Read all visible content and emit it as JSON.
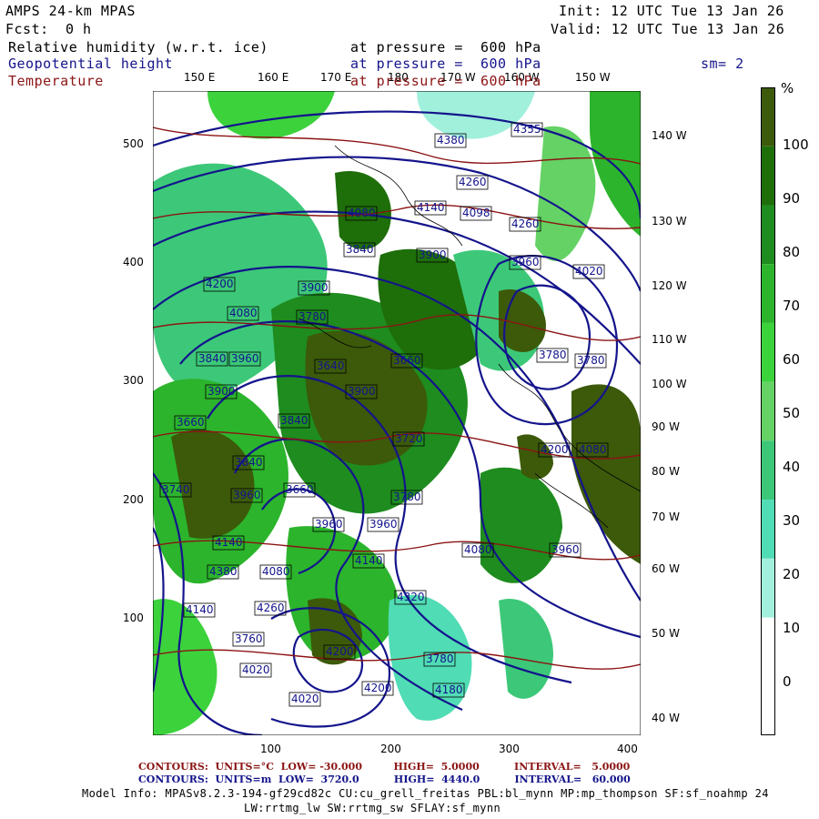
{
  "header": {
    "model": "AMPS 24-km MPAS",
    "init": "Init: 12 UTC Tue 13 Jan 26",
    "fcst_label": "Fcst:",
    "fcst_value": "0 h",
    "valid": "Valid: 12 UTC Tue 13 Jan 26",
    "smoothing": "sm= 2"
  },
  "fields": [
    {
      "name": "Relative humidity (w.r.t. ice)",
      "level": "at pressure =  600 hPa",
      "color": "#000000"
    },
    {
      "name": "Geopotential height",
      "level": "at pressure =  600 hPa",
      "color": "#14148c"
    },
    {
      "name": "Temperature",
      "level": "at pressure =  600 hPa",
      "color": "#8c1414"
    }
  ],
  "top_longitudes": [
    "150 E",
    "160 E",
    "170 E",
    "180",
    "170 W",
    "160 W",
    "150 W"
  ],
  "right_longitudes": [
    "140 W",
    "130 W",
    "120 W",
    "110 W",
    "100 W",
    "90 W",
    "80 W",
    "70 W",
    "60 W",
    "50 W",
    "40 W"
  ],
  "y_ticks": [
    "500",
    "400",
    "300",
    "200",
    "100"
  ],
  "x_ticks": [
    "100",
    "200",
    "300",
    "400"
  ],
  "colorbar": {
    "unit": "%",
    "labels": [
      "100",
      "90",
      "80",
      "70",
      "60",
      "50",
      "40",
      "30",
      "20",
      "10",
      "0"
    ],
    "colors": [
      "#3c5a0a",
      "#1e6e0a",
      "#1e8c1e",
      "#2cb42c",
      "#3cd23c",
      "#64d264",
      "#3cc878",
      "#50dcb4",
      "#a0f0dc",
      "#ffffff",
      "#ffffff"
    ]
  },
  "height_labels": [
    "4380",
    "4355",
    "4260",
    "4080",
    "4140",
    "4098",
    "4260",
    "3840",
    "3900",
    "3960",
    "4020",
    "4200",
    "3900",
    "4080",
    "3780",
    "3840",
    "3960",
    "3640",
    "3660",
    "3780",
    "3780",
    "3900",
    "3900",
    "3660",
    "3840",
    "3720",
    "3840",
    "3660",
    "3740",
    "3780",
    "3960",
    "4200",
    "4080",
    "3960",
    "3960",
    "4140",
    "4380",
    "4080",
    "4080",
    "3960",
    "4140",
    "4140",
    "4260",
    "4320",
    "3760",
    "4020",
    "4200",
    "4200",
    "3780",
    "4180",
    "4020"
  ],
  "footer": {
    "temp_contours": "CONTOURS:  UNITS=°C  LOW= -30.000         HIGH=  5.0000          INTERVAL=   5.0000",
    "height_contours": "CONTOURS:  UNITS=m  LOW=  3720.0          HIGH=  4440.0          INTERVAL=   60.000",
    "model_info_1": "Model Info: MPASv8.2.3-194-gf29cd82c CU:cu_grell_freitas PBL:bl_mynn MP:mp_thompson SF:sf_noahmp 24",
    "model_info_2": "LW:rrtmg_lw SW:rrtmg_sw SFLAY:sf_mynn"
  }
}
